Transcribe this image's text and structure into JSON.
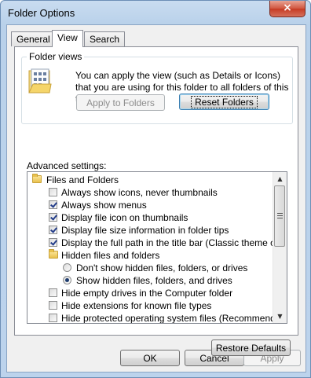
{
  "window": {
    "title": "Folder Options",
    "close_glyph": "×"
  },
  "tabs": [
    {
      "label": "General",
      "active": false
    },
    {
      "label": "View",
      "active": true
    },
    {
      "label": "Search",
      "active": false
    }
  ],
  "folder_views": {
    "legend": "Folder views",
    "description": "You can apply the view (such as Details or Icons) that you are using for this folder to all folders of this type.",
    "apply_button": "Apply to Folders",
    "reset_button": "Reset Folders",
    "icon": "folder-views-icon"
  },
  "advanced": {
    "label": "Advanced settings:",
    "items": [
      {
        "type": "folder",
        "level": 0,
        "label": "Files and Folders"
      },
      {
        "type": "checkbox",
        "level": 1,
        "checked": false,
        "label": "Always show icons, never thumbnails"
      },
      {
        "type": "checkbox",
        "level": 1,
        "checked": true,
        "label": "Always show menus"
      },
      {
        "type": "checkbox",
        "level": 1,
        "checked": true,
        "label": "Display file icon on thumbnails"
      },
      {
        "type": "checkbox",
        "level": 1,
        "checked": true,
        "label": "Display file size information in folder tips"
      },
      {
        "type": "checkbox",
        "level": 1,
        "checked": true,
        "label": "Display the full path in the title bar (Classic theme only)"
      },
      {
        "type": "folder",
        "level": 1,
        "label": "Hidden files and folders"
      },
      {
        "type": "radio",
        "level": 2,
        "checked": false,
        "label": "Don't show hidden files, folders, or drives"
      },
      {
        "type": "radio",
        "level": 2,
        "checked": true,
        "label": "Show hidden files, folders, and drives"
      },
      {
        "type": "checkbox",
        "level": 1,
        "checked": false,
        "label": "Hide empty drives in the Computer folder"
      },
      {
        "type": "checkbox",
        "level": 1,
        "checked": false,
        "label": "Hide extensions for known file types"
      },
      {
        "type": "checkbox",
        "level": 1,
        "checked": false,
        "label": "Hide protected operating system files (Recommended)"
      }
    ]
  },
  "restore_button": "Restore Defaults",
  "footer": {
    "ok": "OK",
    "cancel": "Cancel",
    "apply": "Apply"
  }
}
